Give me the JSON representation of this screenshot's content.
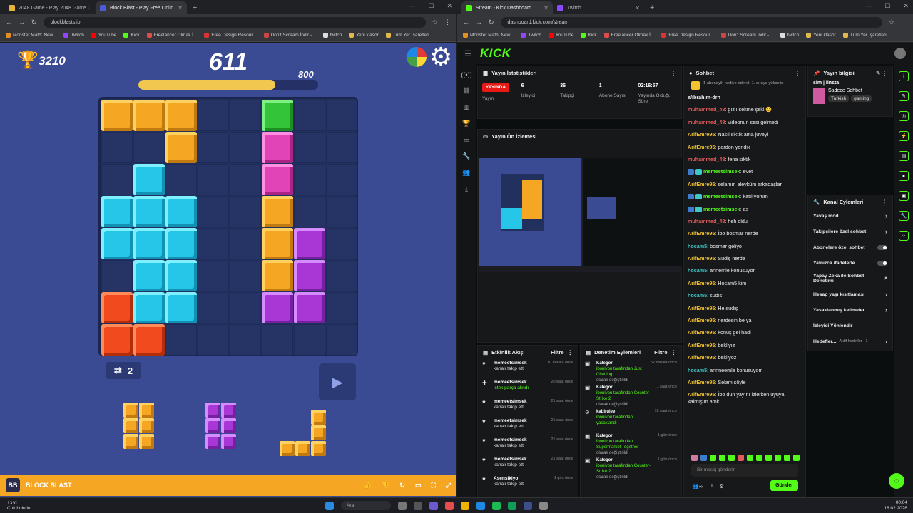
{
  "left_window": {
    "tabs": [
      {
        "label": "2048 Game - Play 2048 Game O",
        "active": false,
        "color": "#e8b33c"
      },
      {
        "label": "Block Blast - Play Free Onlin",
        "active": true,
        "color": "#4b5bd6"
      }
    ],
    "url": "blockblasts.io",
    "bookmarks": [
      "Monster Math: New...",
      "Twitch",
      "YouTube",
      "Kick",
      "Freelancer Olmak İ...",
      "Free Design Resour...",
      "Don't Scream İndir -...",
      "twitch",
      "Yeni klasör",
      "Tüm Yer İşaretleri"
    ]
  },
  "game": {
    "score": "3210",
    "moves": "611",
    "target": "800",
    "progress_fraction": 0.76,
    "swap_count": "2",
    "footer_title": "BLOCK BLAST",
    "board": [
      "ooo..g..",
      "..o..m..",
      ".c...m..",
      "ccc..o..",
      "ccc..op.",
      ".cc..op.",
      "rcc..pp.",
      "rr......"
    ],
    "pieces": [
      {
        "color": "o",
        "cells": [
          [
            0,
            0
          ],
          [
            1,
            0
          ],
          [
            0,
            1
          ],
          [
            1,
            1
          ],
          [
            0,
            2
          ],
          [
            1,
            2
          ]
        ]
      },
      {
        "color": "p",
        "cells": [
          [
            0,
            0
          ],
          [
            1,
            0
          ],
          [
            0,
            1
          ],
          [
            1,
            1
          ],
          [
            0,
            2
          ],
          [
            1,
            2
          ]
        ]
      },
      {
        "color": "o",
        "cells": [
          [
            2,
            0
          ],
          [
            2,
            1
          ],
          [
            0,
            2
          ],
          [
            1,
            2
          ],
          [
            2,
            2
          ]
        ]
      }
    ]
  },
  "right_window": {
    "tabs": [
      {
        "label": "Stream - Kick Dashboard",
        "active": true,
        "color": "#53fc18"
      },
      {
        "label": "Twitch",
        "active": false,
        "color": "#9146ff"
      }
    ],
    "url": "dashboard.kick.com/stream",
    "bookmarks": [
      "Monster Math: New...",
      "Twitch",
      "YouTube",
      "Kick",
      "Freelancer Olmak İ...",
      "Free Design Resour...",
      "Don't Scream İndir -...",
      "twitch",
      "Yeni klasör",
      "Tüm Yer İşaretleri"
    ]
  },
  "kick": {
    "logo": "KICK",
    "stats_title": "Yayın İstatistikleri",
    "live_label": "YAYINDA",
    "stats": [
      {
        "value": "",
        "label": "Yayın"
      },
      {
        "value": "6",
        "label": "İzleyici"
      },
      {
        "value": "36",
        "label": "Takipçi"
      },
      {
        "value": "1",
        "label": "Abone Sayısı"
      },
      {
        "value": "02:16:57",
        "label": "Yayında Olduğu Süre"
      }
    ],
    "preview_title": "Yayın Ön İzlemesi",
    "activity_title": "Etkinlik Akışı",
    "activity_filter": "Filtre",
    "activity": [
      {
        "user": "memeetsimsek",
        "text": "kanalı takip etti",
        "time": "10 dakika önce"
      },
      {
        "user": "memeetsimsek",
        "text": "istek parça alındı",
        "time": "20 saat önce"
      },
      {
        "user": "memeetsimsek",
        "text": "kanalı takip etti",
        "time": "21 saat önce"
      },
      {
        "user": "memeetsimsek",
        "text": "kanalı takip etti",
        "time": "21 saat önce"
      },
      {
        "user": "memeetsimsek",
        "text": "kanalı takip etti",
        "time": "21 saat önce"
      },
      {
        "user": "memeetsimsek",
        "text": "kanalı takip etti",
        "time": "21 saat önce"
      },
      {
        "user": "Asensikiyo",
        "text": "kanalı takip etti",
        "time": "1 gün önce"
      }
    ],
    "mod_title": "Denetim Eylemleri",
    "mod_filter": "Filtre",
    "mod": [
      {
        "title": "Kategori",
        "line1": "ibonivon tarafından Just Chatting",
        "line2": "olarak değiştirildi",
        "time": "52 dakika önce"
      },
      {
        "title": "Kategori",
        "line1": "ibonivon tarafından Counter-Strike 2",
        "line2": "olarak değiştirildi",
        "time": "1 saat önce"
      },
      {
        "title": "kabirulee",
        "line1": "ibonivon tarafından yasaklandı",
        "line2": "",
        "time": "18 saat önce"
      },
      {
        "title": "Kategori",
        "line1": "ibonivon tarafından Supermarket Together",
        "line2": "olarak değiştirildi",
        "time": "1 gün önce"
      },
      {
        "title": "Kategori",
        "line1": "ibonivon tarafından Counter-Strike 2",
        "line2": "olarak değiştirildi",
        "time": "1 gün önce"
      }
    ],
    "chat_title": "Sohbet",
    "chat_banner": "1 aboneyik hediye ederek 1. sıraya yükselin",
    "chat": [
      {
        "user": "",
        "cls": "",
        "text": "e/ibrahim-drn",
        "badge": false
      },
      {
        "user": "muhammed_48",
        "cls": "u1",
        "text": "gızlı sekme şekli😊",
        "badge": false
      },
      {
        "user": "muhammed_48",
        "cls": "u1",
        "text": "videonun sesi gelmedi",
        "badge": false
      },
      {
        "user": "ArifEmre95",
        "cls": "u2",
        "text": "Nasıl siktik ama juveyi",
        "badge": false
      },
      {
        "user": "ArifEmre95",
        "cls": "u2",
        "text": "pardon yendik",
        "badge": false
      },
      {
        "user": "muhammed_48",
        "cls": "u1",
        "text": "fena siktik",
        "badge": false
      },
      {
        "user": "memeetsimsek",
        "cls": "u3",
        "text": "evet",
        "badge": true
      },
      {
        "user": "ArifEmre95",
        "cls": "u2",
        "text": "selamın aleyküm arkadaşlar",
        "badge": false
      },
      {
        "user": "memeetsimsek",
        "cls": "u3",
        "text": "katılıyorum",
        "badge": true
      },
      {
        "user": "memeetsimsek",
        "cls": "u3",
        "text": "as",
        "badge": true
      },
      {
        "user": "muhammed_48",
        "cls": "u1",
        "text": "heh oldu",
        "badge": false
      },
      {
        "user": "ArifEmre95",
        "cls": "u2",
        "text": "İbo bosmar nerde",
        "badge": false
      },
      {
        "user": "hocam5",
        "cls": "u4",
        "text": "bosmar geliyo",
        "badge": false
      },
      {
        "user": "ArifEmre95",
        "cls": "u2",
        "text": "Sudiş nerde",
        "badge": false
      },
      {
        "user": "hocam5",
        "cls": "u4",
        "text": "annemle konusuyon",
        "badge": false
      },
      {
        "user": "ArifEmre95",
        "cls": "u2",
        "text": "Hocam5 kim",
        "badge": false
      },
      {
        "user": "hocam5",
        "cls": "u4",
        "text": "sudıs",
        "badge": false
      },
      {
        "user": "ArifEmre95",
        "cls": "u2",
        "text": "He sudiş",
        "badge": false
      },
      {
        "user": "ArifEmre95",
        "cls": "u2",
        "text": "nerdesin be ya",
        "badge": false
      },
      {
        "user": "ArifEmre95",
        "cls": "u2",
        "text": "konuş gel hadi",
        "badge": false
      },
      {
        "user": "ArifEmre95",
        "cls": "u2",
        "text": "bekliyız",
        "badge": false
      },
      {
        "user": "ArifEmre95",
        "cls": "u2",
        "text": "bekliyoz",
        "badge": false
      },
      {
        "user": "hocam5",
        "cls": "u4",
        "text": "annneemle konusuyom",
        "badge": false
      },
      {
        "user": "ArifEmre95",
        "cls": "u2",
        "text": "Selam söyle",
        "badge": false
      },
      {
        "user": "ArifEmre95",
        "cls": "u2",
        "text": "İbo dün yayını izlerken uyuya kalmışım amk",
        "badge": false
      }
    ],
    "chat_placeholder": "Bir mesaj gönderin",
    "chat_send": "Gönder",
    "chat_count": "0",
    "info_title": "Yayın bilgisi",
    "info_stream_title": "sim | linsta",
    "info_category": "Sadece Sohbet",
    "info_tags": [
      "Turkish",
      "gaming"
    ],
    "actions_title": "Kanal Eylemleri",
    "actions": [
      {
        "label": "Yavaş mod",
        "kind": "chevron"
      },
      {
        "label": "Takipçilere özel sohbet",
        "kind": "chevron"
      },
      {
        "label": "Abonelere özel sohbet",
        "kind": "toggle"
      },
      {
        "label": "Yalnızca ifadelerle...",
        "kind": "toggle"
      },
      {
        "label": "Yapay Zeka ile Sohbet Denetimi",
        "kind": "ext"
      },
      {
        "label": "Hesap yaşı kısıtlaması",
        "kind": "chevron"
      },
      {
        "label": "Yasaklanmış kelimeler",
        "kind": "chevron"
      },
      {
        "label": "İzleyici Yönlendir",
        "kind": "none"
      },
      {
        "label": "Hedefler...",
        "kind": "goal",
        "extra": "Aktif hedefler - 1"
      }
    ]
  },
  "taskbar": {
    "temp": "13°C",
    "weather": "Çok bulutlu",
    "search": "Ara",
    "time": "00:04",
    "date": "18.02.2026"
  }
}
